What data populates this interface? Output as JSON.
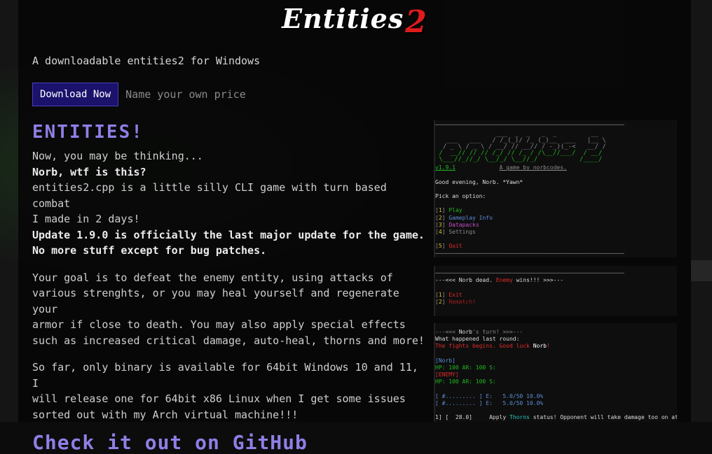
{
  "banner": {
    "logo_main": "Entities",
    "logo_num": "2"
  },
  "subtitle": "A downloadable entities2 for Windows",
  "buy": {
    "button": "Download Now",
    "price_text": "Name your own price"
  },
  "heading": "ENTITIES!",
  "intro": {
    "l1": "Now, you may be thinking...",
    "l2": "Norb, wtf is this?",
    "l3": "entities2.cpp is a little silly CLI game with turn based combat",
    "l4": "I made in 2 days!",
    "l5": "Update 1.9.0 is officially the last major update for the game.",
    "l6": "No more stuff except for bug patches."
  },
  "para2": {
    "l1": "Your goal is to defeat the enemy entity, using attacks of",
    "l2": "various strenghts, or you may heal yourself and regenerate your",
    "l3": "armor if close to death. You may also apply special effects",
    "l4": "such as increased critical damage, auto-heal, thorns and more!"
  },
  "para3": {
    "l1": "So far, only binary is available for 64bit Windows 10 and 11, I",
    "l2": "will release one for 64bit x86 Linux when I get some issues",
    "l3": "sorted out with my Arch virtual machine!!!"
  },
  "github_heading": "Check it out on GitHub",
  "shot1": {
    "version": "v1.9.1",
    "credit": "A game by norbcodes.",
    "greeting": "Good evening, Norb. *Yawn*",
    "prompt": "Pick an option:",
    "options": [
      {
        "key": "1",
        "label": "Play"
      },
      {
        "key": "2",
        "label": "Gameplay Info"
      },
      {
        "key": "3",
        "label": "Datapacks"
      },
      {
        "key": "4",
        "label": "Settings"
      },
      {
        "key": "5",
        "label": "Quit"
      }
    ]
  },
  "shot2": {
    "pre": "---<<< ",
    "player": "Norb",
    "dead": " dead. ",
    "enemy": "Enemy",
    "wins": " wins!!! >>>---",
    "opt1_key": "1",
    "opt1": "Exit",
    "opt2_key": "2",
    "opt2": "Rematch!"
  },
  "shot3": {
    "turn_pre": "---<<< ",
    "turn_name": "Norb",
    "turn_post": "'s turn! >>>---",
    "last_round": "What happened last round:",
    "fight_begin": "The fights begins. Good luck ",
    "fight_name": "Norb",
    "fight_end": "!",
    "player_tag": "[Norb]",
    "stats_1": "HP: 100 AR: 100 S:",
    "enemy_tag": "[ENEMY]",
    "stats_2": "HP: 100 AR: 100 S:",
    "bar1": "[ #......... ] E:   5.0/50 10.0%",
    "bar2": "[ #......... ] E:   5.0/50 10.0%",
    "attack_line_pre": "1] [  28.0]     Apply ",
    "attack_status": "Thorns",
    "attack_line_post": " status! Opponent will take damage too on attack"
  }
}
